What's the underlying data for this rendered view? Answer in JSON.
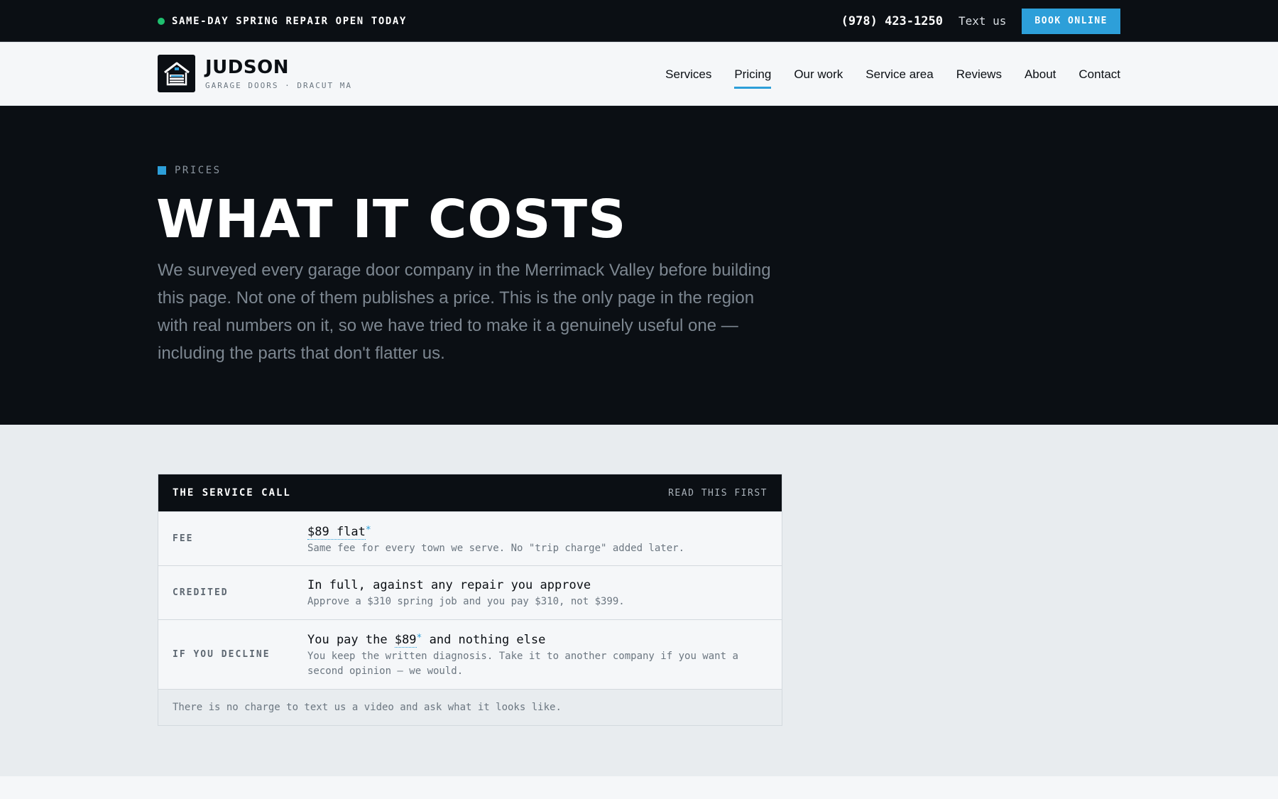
{
  "topbar": {
    "promo": "SAME-DAY SPRING REPAIR OPEN TODAY",
    "phone": "(978) 423-1250",
    "text_us": "Text us",
    "book_label": "BOOK ONLINE"
  },
  "brand": {
    "name": "JUDSON",
    "tagline": "GARAGE DOORS · DRACUT MA"
  },
  "nav": {
    "items": [
      "Services",
      "Pricing",
      "Our work",
      "Service area",
      "Reviews",
      "About",
      "Contact"
    ],
    "active": "Pricing"
  },
  "hero": {
    "eyebrow": "PRICES",
    "title": "WHAT IT COSTS",
    "intro": "We surveyed every garage door company in the Merrimack Valley before building this page. Not one of them publishes a price. This is the only page in the region with real numbers on it, so we have tried to make it a genuinely useful one — including the parts that don't flatter us."
  },
  "service_call": {
    "title": "THE SERVICE CALL",
    "note": "READ THIS FIRST",
    "rows": [
      {
        "label": "FEE",
        "main": "$89 flat",
        "asterisk": "*",
        "sub": "Same fee for every town we serve. No \"trip charge\" added later."
      },
      {
        "label": "CREDITED",
        "main": "In full, against any repair you approve",
        "sub": "Approve a $310 spring job and you pay $310, not $399."
      },
      {
        "label": "IF YOU DECLINE",
        "main_before": "You pay the ",
        "main_link": "$89",
        "asterisk": "*",
        "main_after": " and nothing else",
        "sub": "You keep the written diagnosis. Take it to another company if you want a second opinion — we would."
      }
    ],
    "footer": "There is no charge to text us a video and ask what it looks like."
  },
  "colors": {
    "accent": "#2d9fd9",
    "dark": "#0b0f14",
    "status_dot": "#1fbf6f"
  },
  "icons": {
    "logo": "garage-house-icon",
    "status": "status-dot-icon"
  }
}
